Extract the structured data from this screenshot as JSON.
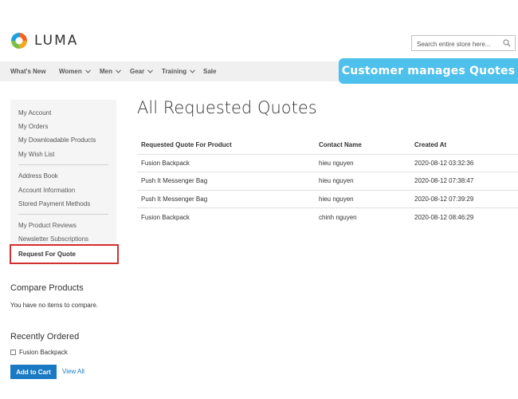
{
  "brand": {
    "name": "LUMA"
  },
  "search": {
    "placeholder": "Search entire store here..."
  },
  "nav": [
    {
      "label": "What's New",
      "has_menu": false
    },
    {
      "label": "Women",
      "has_menu": true
    },
    {
      "label": "Men",
      "has_menu": true
    },
    {
      "label": "Gear",
      "has_menu": true
    },
    {
      "label": "Training",
      "has_menu": true
    },
    {
      "label": "Sale",
      "has_menu": false
    }
  ],
  "banner": {
    "text": "Customer manages Quotes"
  },
  "sidebar": {
    "group1": [
      "My Account",
      "My Orders",
      "My Downloadable Products",
      "My Wish List"
    ],
    "group2": [
      "Address Book",
      "Account Information",
      "Stored Payment Methods"
    ],
    "group3": [
      "My Product Reviews",
      "Newsletter Subscriptions"
    ],
    "current": "Request For Quote"
  },
  "compare": {
    "title": "Compare Products",
    "empty_text": "You have no items to compare."
  },
  "recently_ordered": {
    "title": "Recently Ordered",
    "items": [
      "Fusion Backpack"
    ],
    "add_to_cart_label": "Add to Cart",
    "view_all_label": "View All"
  },
  "main": {
    "title": "All Requested Quotes",
    "columns": [
      "Requested Quote For Product",
      "Contact Name",
      "Created At"
    ],
    "rows": [
      [
        "Fusion Backpack",
        "hieu nguyen",
        "2020-08-12 03:32:36"
      ],
      [
        "Push It Messenger Bag",
        "hieu nguyen",
        "2020-08-12 07:38:47"
      ],
      [
        "Push It Messenger Bag",
        "hieu nguyen",
        "2020-08-12 07:39:29"
      ],
      [
        "Fusion Backpack",
        "chinh nguyen",
        "2020-08-12 08:46:29"
      ]
    ]
  },
  "colors": {
    "accent": "#1979c3",
    "banner": "#4ec0ec",
    "highlight": "#d32f2f",
    "nav_bg": "#f0f0f0",
    "sidebar_bg": "#f5f5f5"
  },
  "icons": {
    "logo": "luma-logo-icon",
    "search": "search-icon",
    "menu": "chevron-down-icon"
  }
}
